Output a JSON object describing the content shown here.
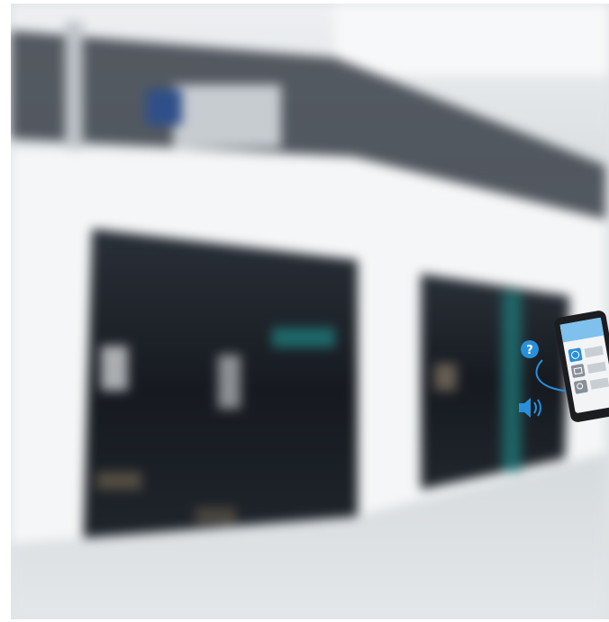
{
  "photo": {
    "description_tag": "blurred-shopping-mall-storefront",
    "palette": {
      "ceiling": "#f1f3f4",
      "wall": "#f4f6f7",
      "glass_dark": "#161a20",
      "floor": "#d9dde0",
      "accent_teal": "#1f7a7a"
    }
  },
  "overlay": {
    "icons": [
      "question-icon",
      "speaker-icon",
      "globe-icon",
      "mail-icon",
      "search-icon"
    ],
    "accent": "#2a8fd8"
  }
}
